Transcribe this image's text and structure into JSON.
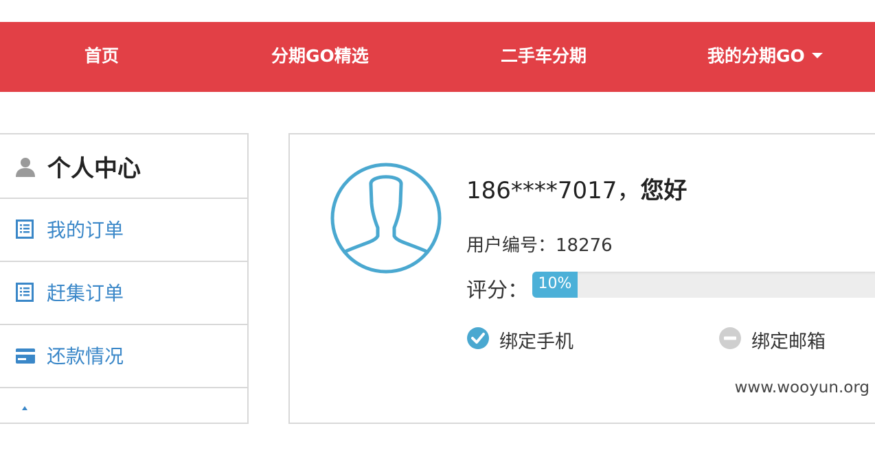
{
  "nav": {
    "items": [
      {
        "label": "首页"
      },
      {
        "label": "分期GO精选"
      },
      {
        "label": "二手车分期"
      },
      {
        "label": "我的分期GO"
      }
    ]
  },
  "sidebar": {
    "title": "个人中心",
    "items": [
      {
        "label": "我的订单",
        "icon": "list-icon"
      },
      {
        "label": "赶集订单",
        "icon": "list-icon"
      },
      {
        "label": "还款情况",
        "icon": "credit-card-icon"
      }
    ]
  },
  "profile": {
    "greeting_phone": "186****7017，",
    "greeting_word": "您好",
    "user_id_label": "用户编号：",
    "user_id": "18276",
    "score_label": "评分：",
    "score_percent": 10,
    "score_text": "10%",
    "bind_phone_label": "绑定手机",
    "bind_phone_status": "bound",
    "bind_email_label": "绑定邮箱",
    "bind_email_status": "unbound"
  },
  "watermark": "www.wooyun.org",
  "colors": {
    "nav_bg": "#e24046",
    "link": "#3a87c8",
    "progress": "#4bb0d8",
    "avatar": "#4aa8d0"
  }
}
